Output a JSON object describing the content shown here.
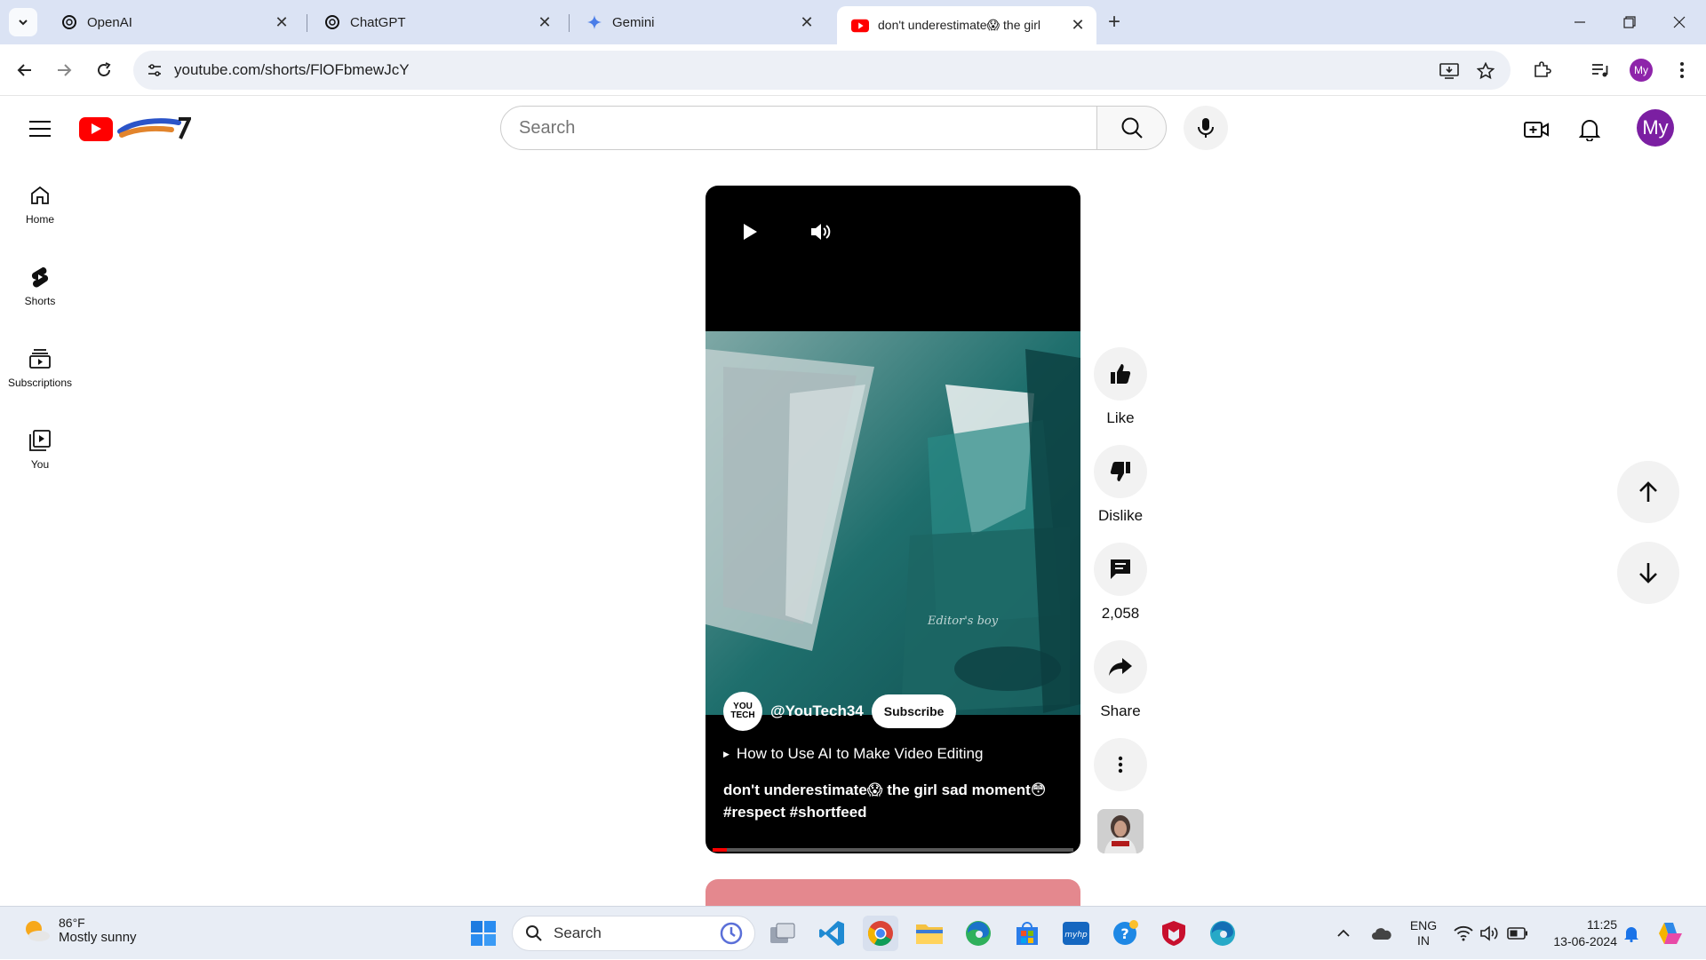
{
  "browser": {
    "tabs": [
      {
        "title": "OpenAI",
        "icon": "openai-icon"
      },
      {
        "title": "ChatGPT",
        "icon": "openai-icon"
      },
      {
        "title": "Gemini",
        "icon": "gemini-icon"
      },
      {
        "title": "don't underestimate😱 the girl",
        "icon": "youtube-icon",
        "active": true
      }
    ],
    "url": "youtube.com/shorts/FlOFbmewJcY",
    "profile_initials": "My"
  },
  "youtube": {
    "search_placeholder": "Search",
    "avatar_initials": "My",
    "nav": [
      {
        "label": "Home",
        "icon": "home-icon"
      },
      {
        "label": "Shorts",
        "icon": "shorts-icon"
      },
      {
        "label": "Subscriptions",
        "icon": "subscriptions-icon"
      },
      {
        "label": "You",
        "icon": "you-icon"
      }
    ]
  },
  "short": {
    "channel_badge": "YOU TECH",
    "channel": "@YouTech34",
    "subscribe_label": "Subscribe",
    "related_video": "How to Use AI to Make Video Editing",
    "caption_line1": "don't underestimate😱 the girl sad moment😳",
    "caption_line2": "#respect #shortfeed",
    "watermark": "Editor's boy",
    "progress_fraction": 0.04
  },
  "actions": {
    "like_label": "Like",
    "dislike_label": "Dislike",
    "comments_count": "2,058",
    "share_label": "Share"
  },
  "taskbar": {
    "weather_temp": "86°F",
    "weather_condition": "Mostly sunny",
    "search_label": "Search",
    "language_line1": "ENG",
    "language_line2": "IN",
    "time": "11:25",
    "date": "13-06-2024"
  },
  "colors": {
    "youtube_red": "#ff0000",
    "avatar_purple": "#7b1fa2",
    "tabstrip": "#dbe3f4"
  }
}
